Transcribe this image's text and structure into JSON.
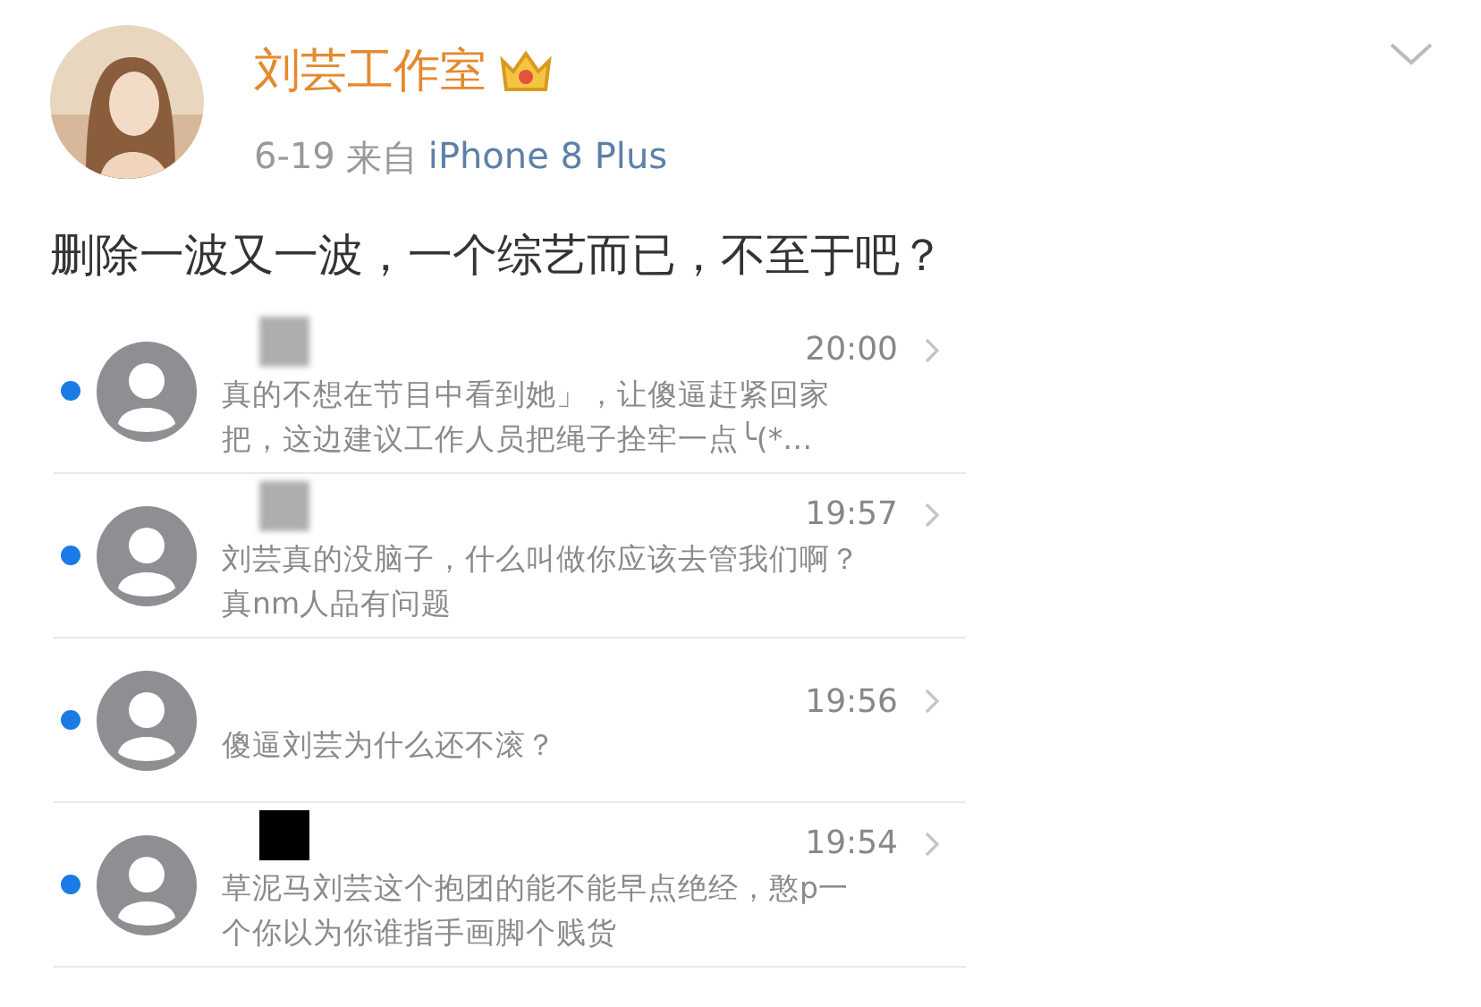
{
  "post": {
    "author": "刘芸工作室",
    "date": "6-19",
    "source_prefix": "来自",
    "source": "iPhone 8 Plus",
    "text": "删除一波又一波，一个综艺而已，不至于吧？"
  },
  "messages": [
    {
      "time": "20:00",
      "text": "真的不想在节目中看到她」，让傻逼赶紧回家把，这边建议工作人员把绳子拴牢一点╰(*…",
      "unread": true,
      "kind": "blurred"
    },
    {
      "time": "19:57",
      "text": "刘芸真的没脑子，什么叫做你应该去管我们啊？真nm人品有问题",
      "unread": true,
      "kind": "blurred"
    },
    {
      "time": "19:56",
      "text": "傻逼刘芸为什么还不滚？",
      "unread": true,
      "kind": "plain"
    },
    {
      "time": "19:54",
      "text": "草泥马刘芸这个抱团的能不能早点绝经，憨p一个你以为你谁指手画脚个贱货",
      "unread": true,
      "kind": "blacked"
    }
  ]
}
